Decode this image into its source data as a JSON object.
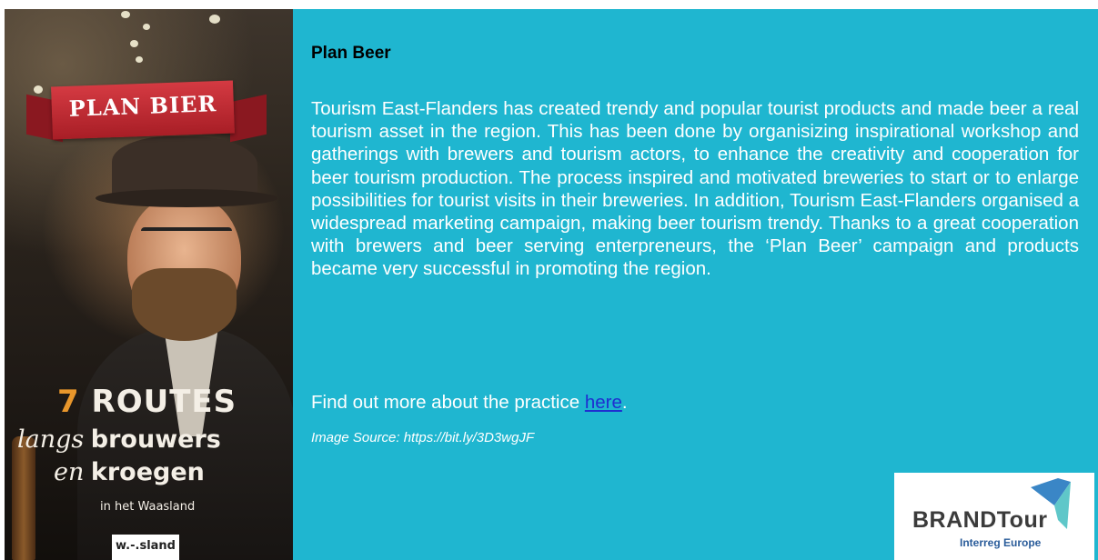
{
  "poster": {
    "ribbon": "PLAN BIER",
    "routes_num": "7",
    "routes_word": "ROUTES",
    "langs": "langs",
    "brouwers": "brouwers",
    "en": "en",
    "kroegen": "kroegen",
    "waasland": "in het Waasland",
    "logo": "w.-.sland"
  },
  "panel": {
    "title": "Plan Beer",
    "body": "Tourism East-Flanders has created trendy and popular tourist products and made beer a real tourism asset in the region. This has been done by organisizing inspirational workshop and gatherings with brewers and tourism actors, to enhance the creativity and cooperation for beer tourism production. The process inspired and motivated breweries to start or to enlarge possibilities for tourist visits in their breweries. In addition, Tourism East-Flanders organised a widespread marketing campaign, making beer tourism trendy. Thanks to a great cooperation with brewers and beer serving enterpreneurs, the ‘Plan Beer’ campaign and products became very successful in promoting the region.",
    "more_prefix": "Find out more about the practice ",
    "more_link": "here",
    "more_suffix": ".",
    "source": "Image Source: https://bit.ly/3D3wgJF"
  },
  "logo": {
    "name": "BRANDTour",
    "sub": "Interreg Europe"
  },
  "colors": {
    "panel_bg": "#1fb6d0",
    "link": "#1f2fd0",
    "ribbon": "#c52d35",
    "logo_blue": "#3a86c6",
    "logo_teal": "#5fc7c9"
  }
}
